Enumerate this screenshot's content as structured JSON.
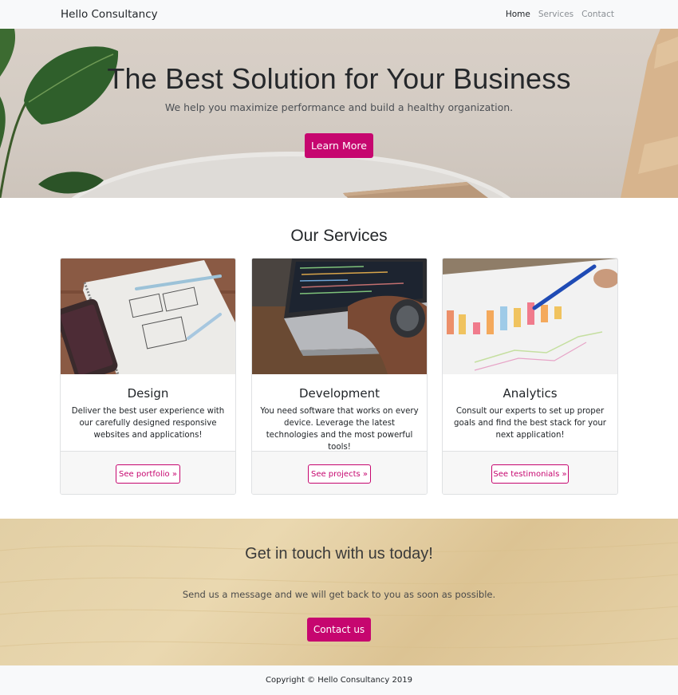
{
  "navbar": {
    "brand": "Hello Consultancy",
    "links": [
      {
        "label": "Home",
        "active": true
      },
      {
        "label": "Services",
        "active": false
      },
      {
        "label": "Contact",
        "active": false
      }
    ]
  },
  "hero": {
    "title": "The Best Solution for Your Business",
    "subtitle": "We help you maximize performance and build a healthy organization.",
    "button_label": "Learn More"
  },
  "services": {
    "title": "Our Services",
    "cards": [
      {
        "title": "Design",
        "text": "Deliver the best user experience with our carefully designed responsive websites and applications!",
        "button_label": "See portfolio »"
      },
      {
        "title": "Development",
        "text": "You need software that works on every device. Leverage the latest technologies and the most powerful tools!",
        "button_label": "See projects »"
      },
      {
        "title": "Analytics",
        "text": "Consult our experts to set up proper goals and find the best stack for your next application!",
        "button_label": "See testimonials »"
      }
    ]
  },
  "contact": {
    "title": "Get in touch with us today!",
    "text": "Send us a message and we will get back to you as soon as possible.",
    "button_label": "Contact us"
  },
  "footer": {
    "copyright": "Copyright © Hello Consultancy 2019"
  },
  "colors": {
    "accent": "#c6066f",
    "navbar_bg": "#f8f9fa",
    "card_border": "#dfe1e3"
  }
}
